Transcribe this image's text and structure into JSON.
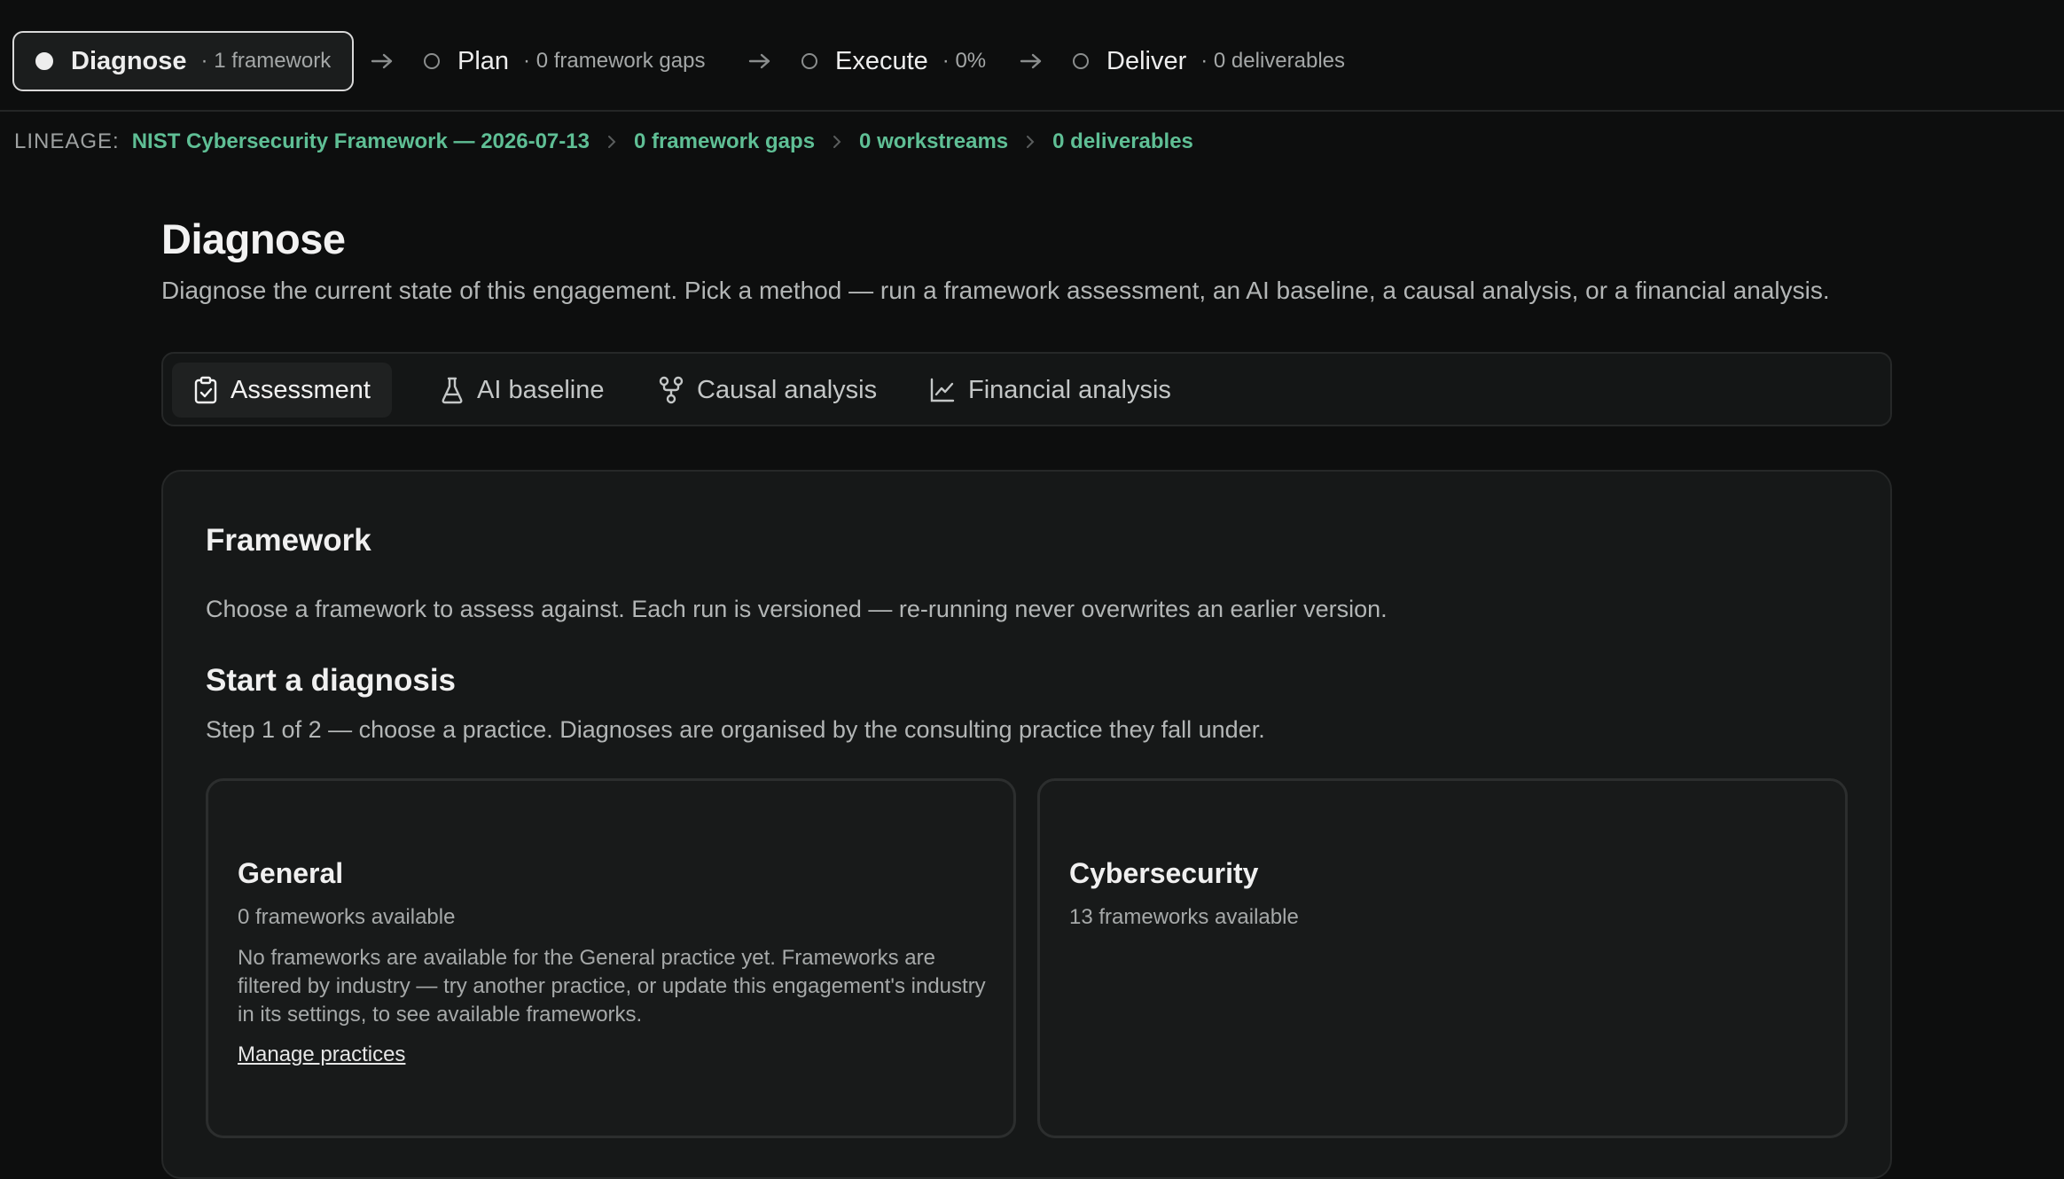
{
  "steps": [
    {
      "label": "Diagnose",
      "meta": "· 1 framework",
      "active": true
    },
    {
      "label": "Plan",
      "meta": "· 0 framework gaps",
      "active": false
    },
    {
      "label": "Execute",
      "meta": "· 0%",
      "active": false
    },
    {
      "label": "Deliver",
      "meta": "· 0 deliverables",
      "active": false
    }
  ],
  "lineage": {
    "label": "LINEAGE:",
    "items": [
      "NIST Cybersecurity Framework — 2026-07-13",
      "0 framework gaps",
      "0 workstreams",
      "0 deliverables"
    ]
  },
  "page": {
    "title": "Diagnose",
    "description": "Diagnose the current state of this engagement. Pick a method — run a framework assessment, an AI baseline, a causal analysis, or a financial analysis."
  },
  "tabs": [
    {
      "label": "Assessment",
      "icon": "clipboard-check-icon",
      "active": true
    },
    {
      "label": "AI baseline",
      "icon": "flask-icon",
      "active": false
    },
    {
      "label": "Causal analysis",
      "icon": "git-fork-icon",
      "active": false
    },
    {
      "label": "Financial analysis",
      "icon": "line-chart-icon",
      "active": false
    }
  ],
  "framework": {
    "title": "Framework",
    "description": "Choose a framework to assess against. Each run is versioned — re-running never overwrites an earlier version."
  },
  "diagnosis": {
    "title": "Start a diagnosis",
    "description": "Step 1 of 2 — choose a practice. Diagnoses are organised by the consulting practice they fall under."
  },
  "practices": [
    {
      "name": "General",
      "count": "0 frameworks available",
      "note": "No frameworks are available for the General practice yet. Frameworks are filtered by industry — try another practice, or update this engagement's industry in its settings, to see available frameworks.",
      "link": "Manage practices"
    },
    {
      "name": "Cybersecurity",
      "count": "13 frameworks available"
    }
  ],
  "colors": {
    "background": "#0d0e0e",
    "panel": "#161818",
    "accent_green": "#5fbf95",
    "text_primary": "#ededed",
    "text_muted": "#a6a9a9"
  }
}
